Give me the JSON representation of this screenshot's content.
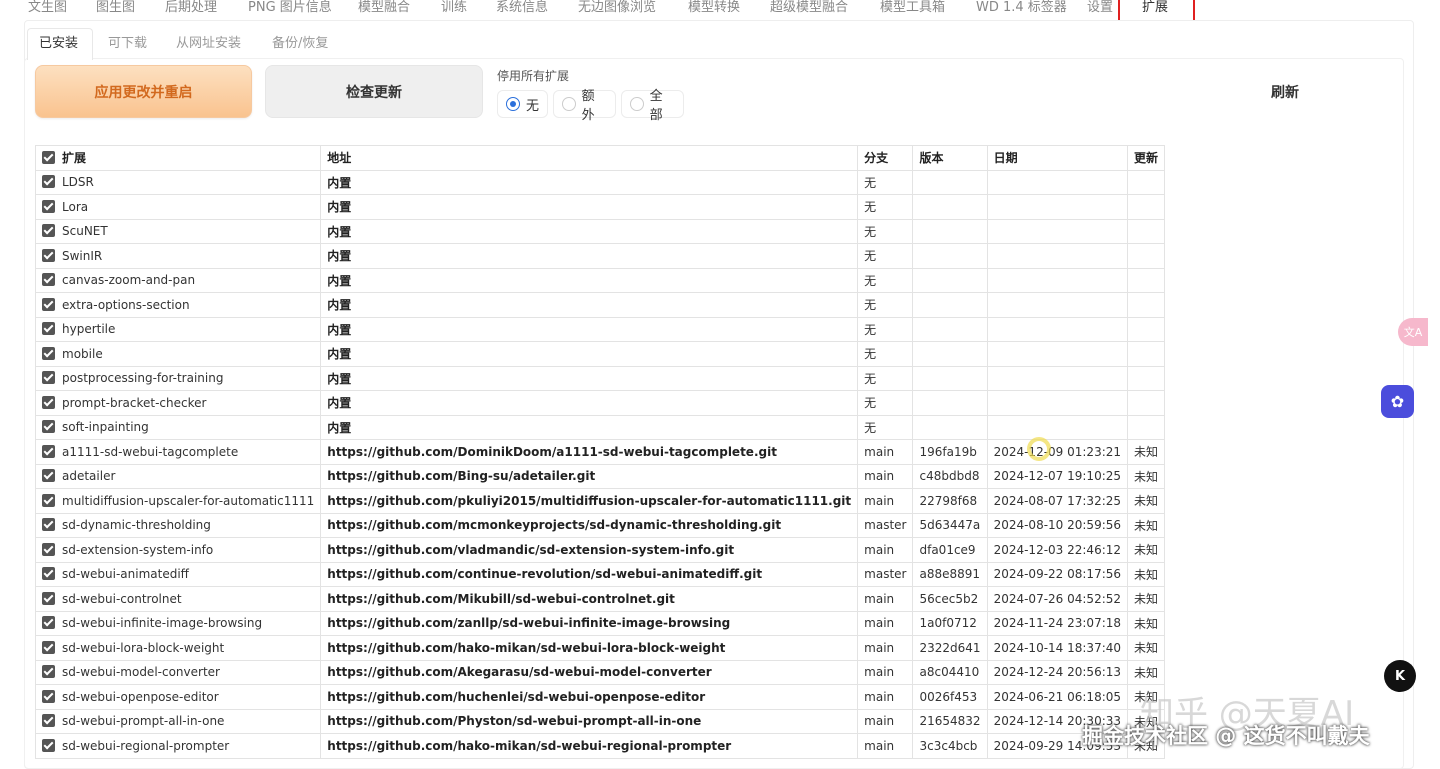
{
  "top_tabs": [
    {
      "label": "文生图"
    },
    {
      "label": "图生图"
    },
    {
      "label": "后期处理"
    },
    {
      "label": "PNG 图片信息"
    },
    {
      "label": "模型融合"
    },
    {
      "label": "训练"
    },
    {
      "label": "系统信息"
    },
    {
      "label": "无边图像浏览"
    },
    {
      "label": "模型转换"
    },
    {
      "label": "超级模型融合"
    },
    {
      "label": "模型工具箱"
    },
    {
      "label": "WD 1.4 标签器"
    },
    {
      "label": "设置"
    },
    {
      "label": "扩展"
    }
  ],
  "sub_tabs": [
    {
      "label": "已安装"
    },
    {
      "label": "可下载"
    },
    {
      "label": "从网址安装"
    },
    {
      "label": "备份/恢复"
    }
  ],
  "actions": {
    "apply_label": "应用更改并重启",
    "check_label": "检查更新",
    "refresh_label": "刷新"
  },
  "disable_all": {
    "label": "停用所有扩展",
    "options": [
      "无",
      "额外",
      "全部"
    ],
    "selected": "无"
  },
  "table": {
    "headers": {
      "name": "扩展",
      "url": "地址",
      "branch": "分支",
      "version": "版本",
      "date": "日期",
      "update": "更新"
    },
    "rows": [
      {
        "name": "LDSR",
        "url": "内置",
        "branch": "无",
        "version": "",
        "date": "",
        "update": ""
      },
      {
        "name": "Lora",
        "url": "内置",
        "branch": "无",
        "version": "",
        "date": "",
        "update": ""
      },
      {
        "name": "ScuNET",
        "url": "内置",
        "branch": "无",
        "version": "",
        "date": "",
        "update": ""
      },
      {
        "name": "SwinIR",
        "url": "内置",
        "branch": "无",
        "version": "",
        "date": "",
        "update": ""
      },
      {
        "name": "canvas-zoom-and-pan",
        "url": "内置",
        "branch": "无",
        "version": "",
        "date": "",
        "update": ""
      },
      {
        "name": "extra-options-section",
        "url": "内置",
        "branch": "无",
        "version": "",
        "date": "",
        "update": ""
      },
      {
        "name": "hypertile",
        "url": "内置",
        "branch": "无",
        "version": "",
        "date": "",
        "update": ""
      },
      {
        "name": "mobile",
        "url": "内置",
        "branch": "无",
        "version": "",
        "date": "",
        "update": ""
      },
      {
        "name": "postprocessing-for-training",
        "url": "内置",
        "branch": "无",
        "version": "",
        "date": "",
        "update": ""
      },
      {
        "name": "prompt-bracket-checker",
        "url": "内置",
        "branch": "无",
        "version": "",
        "date": "",
        "update": ""
      },
      {
        "name": "soft-inpainting",
        "url": "内置",
        "branch": "无",
        "version": "",
        "date": "",
        "update": ""
      },
      {
        "name": "a1111-sd-webui-tagcomplete",
        "url": "https://github.com/DominikDoom/a1111-sd-webui-tagcomplete.git",
        "branch": "main",
        "version": "196fa19b",
        "date": "2024-12-09 01:23:21",
        "update": "未知"
      },
      {
        "name": "adetailer",
        "url": "https://github.com/Bing-su/adetailer.git",
        "branch": "main",
        "version": "c48bdbd8",
        "date": "2024-12-07 19:10:25",
        "update": "未知"
      },
      {
        "name": "multidiffusion-upscaler-for-automatic1111",
        "url": "https://github.com/pkuliyi2015/multidiffusion-upscaler-for-automatic1111.git",
        "branch": "main",
        "version": "22798f68",
        "date": "2024-08-07 17:32:25",
        "update": "未知"
      },
      {
        "name": "sd-dynamic-thresholding",
        "url": "https://github.com/mcmonkeyprojects/sd-dynamic-thresholding.git",
        "branch": "master",
        "version": "5d63447a",
        "date": "2024-08-10 20:59:56",
        "update": "未知"
      },
      {
        "name": "sd-extension-system-info",
        "url": "https://github.com/vladmandic/sd-extension-system-info.git",
        "branch": "main",
        "version": "dfa01ce9",
        "date": "2024-12-03 22:46:12",
        "update": "未知"
      },
      {
        "name": "sd-webui-animatediff",
        "url": "https://github.com/continue-revolution/sd-webui-animatediff.git",
        "branch": "master",
        "version": "a88e8891",
        "date": "2024-09-22 08:17:56",
        "update": "未知"
      },
      {
        "name": "sd-webui-controlnet",
        "url": "https://github.com/Mikubill/sd-webui-controlnet.git",
        "branch": "main",
        "version": "56cec5b2",
        "date": "2024-07-26 04:52:52",
        "update": "未知"
      },
      {
        "name": "sd-webui-infinite-image-browsing",
        "url": "https://github.com/zanllp/sd-webui-infinite-image-browsing",
        "branch": "main",
        "version": "1a0f0712",
        "date": "2024-11-24 23:07:18",
        "update": "未知"
      },
      {
        "name": "sd-webui-lora-block-weight",
        "url": "https://github.com/hako-mikan/sd-webui-lora-block-weight",
        "branch": "main",
        "version": "2322d641",
        "date": "2024-10-14 18:37:40",
        "update": "未知"
      },
      {
        "name": "sd-webui-model-converter",
        "url": "https://github.com/Akegarasu/sd-webui-model-converter",
        "branch": "main",
        "version": "a8c04410",
        "date": "2024-12-24 20:56:13",
        "update": "未知"
      },
      {
        "name": "sd-webui-openpose-editor",
        "url": "https://github.com/huchenlei/sd-webui-openpose-editor",
        "branch": "main",
        "version": "0026f453",
        "date": "2024-06-21 06:18:05",
        "update": "未知"
      },
      {
        "name": "sd-webui-prompt-all-in-one",
        "url": "https://github.com/Physton/sd-webui-prompt-all-in-one",
        "branch": "main",
        "version": "21654832",
        "date": "2024-12-14 20:30:33",
        "update": "未知"
      },
      {
        "name": "sd-webui-regional-prompter",
        "url": "https://github.com/hako-mikan/sd-webui-regional-prompter",
        "branch": "main",
        "version": "3c3c4bcb",
        "date": "2024-09-29 14:09:53",
        "update": "未知"
      }
    ]
  },
  "watermarks": {
    "zhihu": "知乎 @天夏AI",
    "juejin": "掘金技术社区 @ 这货不叫戴夫"
  },
  "floating": {
    "dark_badge": "K"
  },
  "colors": {
    "apply_button": "#f9c38f",
    "radio_selected": "#2a6fdb",
    "active_tab_highlight": "#e02020"
  }
}
